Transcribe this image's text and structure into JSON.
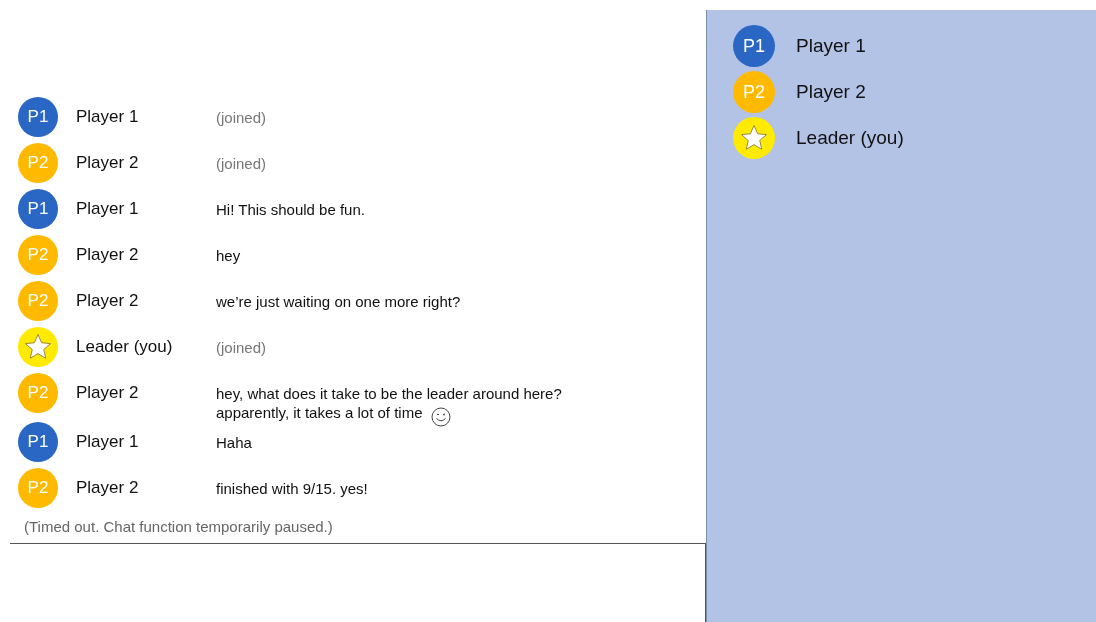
{
  "chat": {
    "messages": [
      {
        "avatar": {
          "kind": "player",
          "label": "P1",
          "color": "#2a66c3"
        },
        "name": "Player 1",
        "kind": "joined",
        "lines": [
          "(joined)"
        ]
      },
      {
        "avatar": {
          "kind": "player",
          "label": "P2",
          "color": "#ffba00"
        },
        "name": "Player 2",
        "kind": "joined",
        "lines": [
          "(joined)"
        ]
      },
      {
        "avatar": {
          "kind": "player",
          "label": "P1",
          "color": "#2a66c3"
        },
        "name": "Player 1",
        "kind": "text",
        "lines": [
          "Hi! This should be fun."
        ]
      },
      {
        "avatar": {
          "kind": "player",
          "label": "P2",
          "color": "#ffba00"
        },
        "name": "Player 2",
        "kind": "text",
        "lines": [
          "hey"
        ]
      },
      {
        "avatar": {
          "kind": "player",
          "label": "P2",
          "color": "#ffba00"
        },
        "name": "Player 2",
        "kind": "text",
        "lines": [
          "we’re just waiting on one more right?"
        ]
      },
      {
        "avatar": {
          "kind": "leader",
          "color": "#ffea00"
        },
        "name": "Leader (you)",
        "kind": "joined",
        "lines": [
          "(joined)"
        ]
      },
      {
        "avatar": {
          "kind": "player",
          "label": "P2",
          "color": "#ffba00"
        },
        "name": "Player 2",
        "kind": "text",
        "lines": [
          "hey, what does it take to be the leader around here?",
          "apparently, it takes a lot of time"
        ],
        "emoticon": true
      },
      {
        "avatar": {
          "kind": "player",
          "label": "P1",
          "color": "#2a66c3"
        },
        "name": "Player 1",
        "kind": "text",
        "lines": [
          "Haha"
        ]
      },
      {
        "avatar": {
          "kind": "player",
          "label": "P2",
          "color": "#ffba00"
        },
        "name": "Player 2",
        "kind": "text",
        "lines": [
          "finished with 9/15. yes!"
        ]
      }
    ],
    "status": "(Timed out. Chat function temporarily paused.)"
  },
  "participants": [
    {
      "avatar": {
        "kind": "player",
        "label": "P1",
        "color": "#2a66c3"
      },
      "name": "Player 1"
    },
    {
      "avatar": {
        "kind": "player",
        "label": "P2",
        "color": "#ffba00"
      },
      "name": "Player 2"
    },
    {
      "avatar": {
        "kind": "leader",
        "color": "#ffea00"
      },
      "name": "Leader (you)"
    }
  ]
}
